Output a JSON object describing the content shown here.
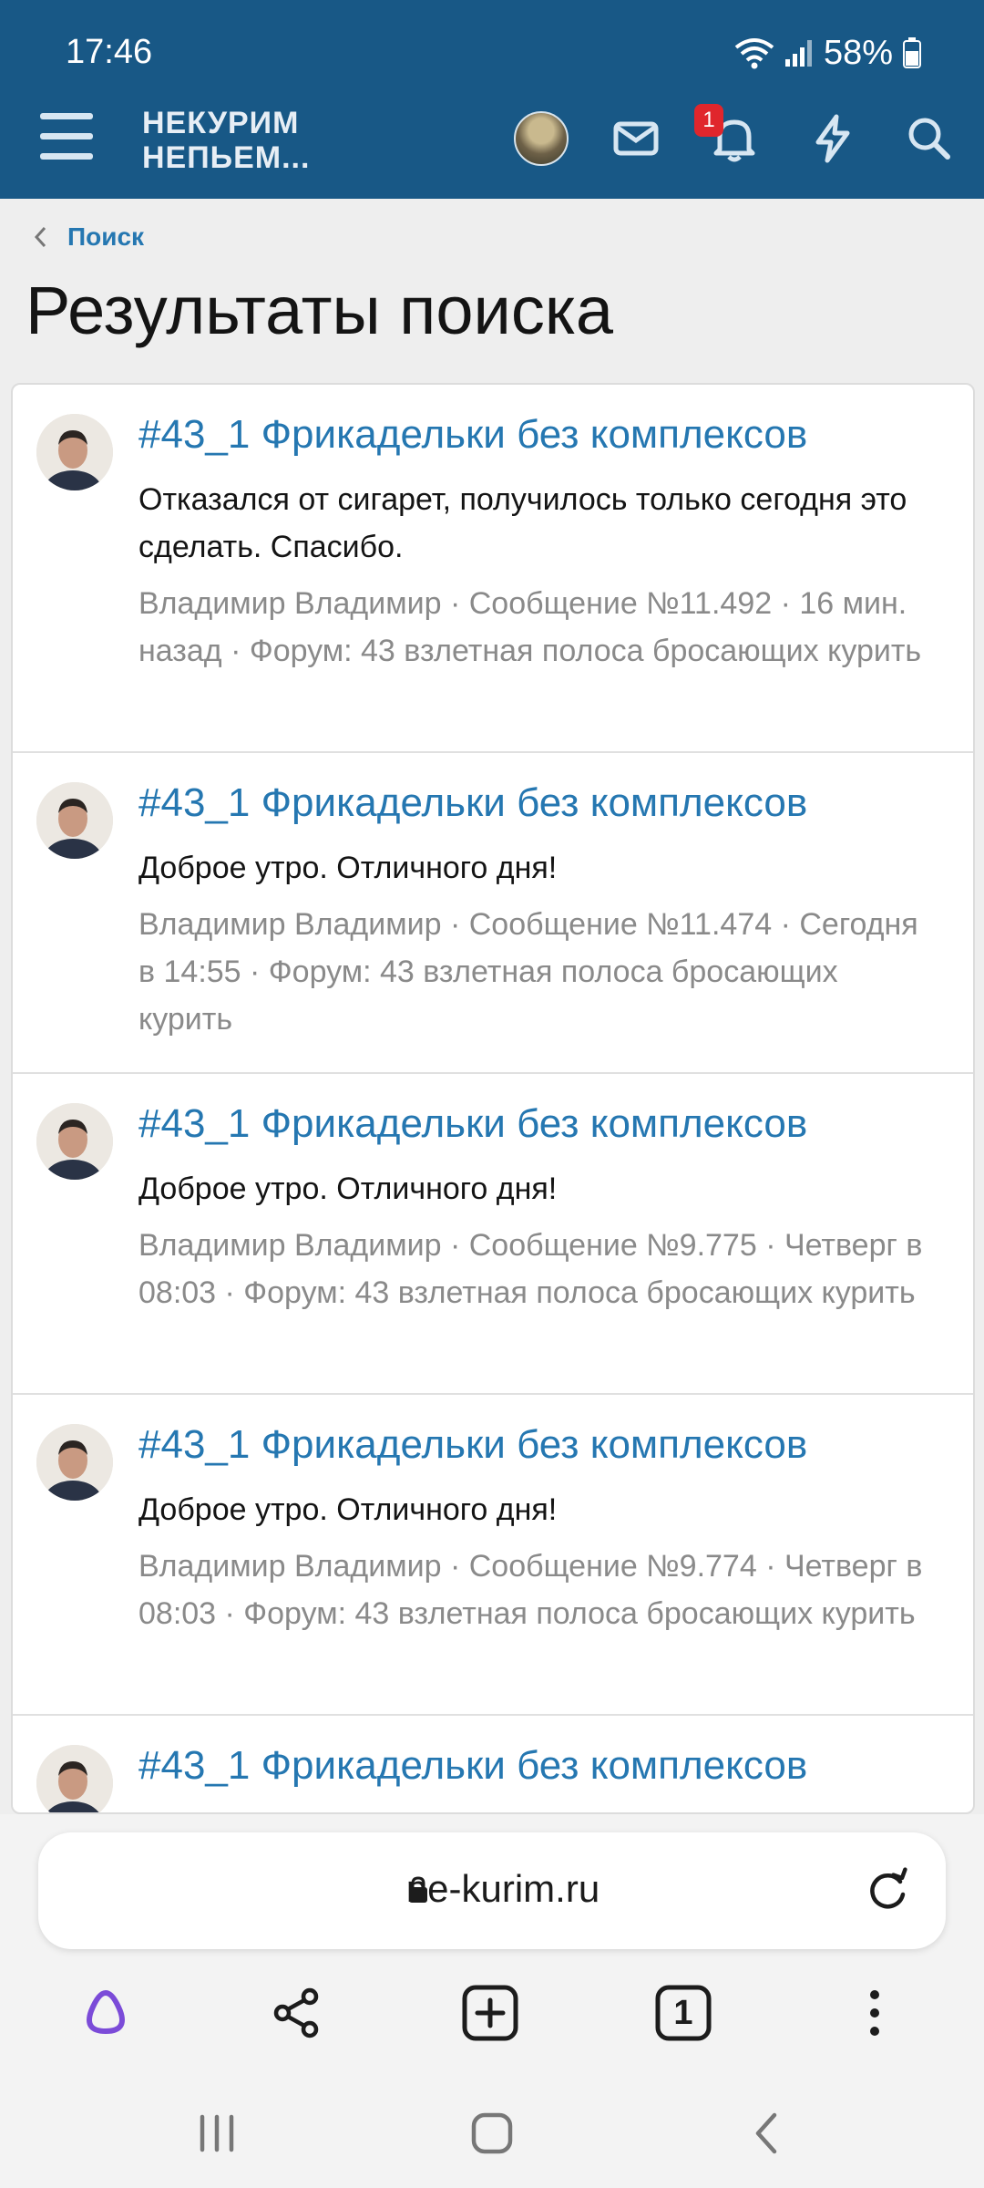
{
  "status_bar": {
    "time": "17:46",
    "battery_percent": "58%"
  },
  "header": {
    "logo_line1": "НЕКУРИМ",
    "logo_line2": "НЕПЬЕМ...",
    "notification_count": "1",
    "icons": [
      "menu-icon",
      "user-avatar",
      "mail-icon",
      "bell-icon",
      "bolt-icon",
      "search-icon"
    ]
  },
  "breadcrumb": {
    "label": "Поиск"
  },
  "page": {
    "title": "Результаты поиска"
  },
  "results": [
    {
      "title": "#43_1 Фрикадельки без комплексов",
      "snippet": "Отказался от сигарет, получилось только сегодня это сделать. Спасибо.",
      "meta": "Владимир Владимир · Сообщение №11.492 · 16 мин. назад · Форум: 43 взлетная полоса бросающих курить"
    },
    {
      "title": "#43_1 Фрикадельки без комплексов",
      "snippet": "Доброе утро. Отличного дня!",
      "meta": "Владимир Владимир · Сообщение №11.474 · Сегодня в 14:55 · Форум: 43 взлетная полоса бросающих курить"
    },
    {
      "title": "#43_1 Фрикадельки без комплексов",
      "snippet": "Доброе утро. Отличного дня!",
      "meta": "Владимир Владимир · Сообщение №9.775 · Четверг в 08:03 · Форум: 43 взлетная полоса бросающих курить"
    },
    {
      "title": "#43_1 Фрикадельки без комплексов",
      "snippet": "Доброе утро. Отличного дня!",
      "meta": "Владимир Владимир · Сообщение №9.774 · Четверг в 08:03 · Форум: 43 взлетная полоса бросающих курить"
    },
    {
      "title": "#43_1 Фрикадельки без комплексов",
      "snippet": "",
      "meta": ""
    }
  ],
  "browser": {
    "url": "ne-kurim.ru",
    "tab_count": "1",
    "toolbar_icons": [
      "alice-icon",
      "share-icon",
      "new-tab-icon",
      "tabs-icon",
      "more-icon"
    ]
  },
  "system_nav": [
    "recents-icon",
    "home-icon",
    "back-icon"
  ],
  "colors": {
    "header_bg": "#185886",
    "link": "#2577b1",
    "meta_text": "#8a8a8a",
    "badge": "#e0262c",
    "alice": "#7b4bd8"
  }
}
